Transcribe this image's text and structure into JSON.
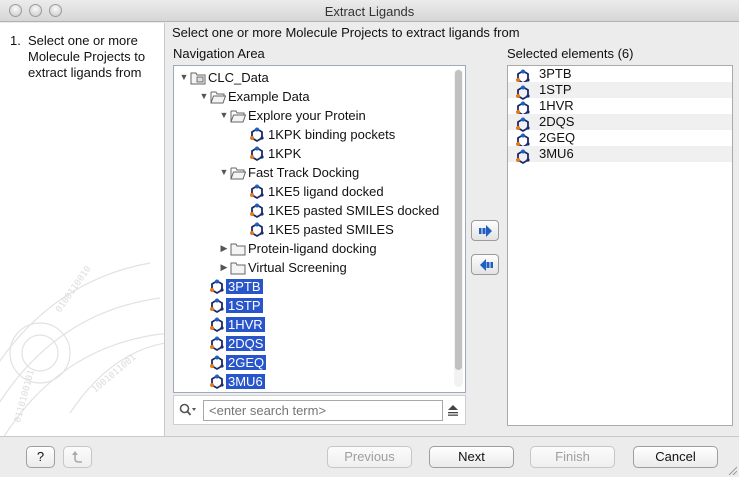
{
  "window": {
    "title": "Extract Ligands"
  },
  "wizard": {
    "steps": [
      {
        "number": "1.",
        "text": "Select one or more Molecule Projects to extract ligands from"
      }
    ],
    "instruction": "Select one or more Molecule Projects to extract ligands from"
  },
  "navigation": {
    "label": "Navigation Area",
    "tree": [
      {
        "label": "CLC_Data",
        "depth": 0,
        "expanded": true,
        "icon": "database-folder-icon"
      },
      {
        "label": "Example Data",
        "depth": 1,
        "expanded": true,
        "icon": "folder-open-icon"
      },
      {
        "label": "Explore your Protein",
        "depth": 2,
        "expanded": true,
        "icon": "folder-open-icon"
      },
      {
        "label": "1KPK binding pockets",
        "depth": 3,
        "icon": "molecule-project-icon"
      },
      {
        "label": "1KPK",
        "depth": 3,
        "icon": "molecule-project-icon"
      },
      {
        "label": "Fast Track Docking",
        "depth": 2,
        "expanded": true,
        "icon": "folder-open-icon"
      },
      {
        "label": "1KE5 ligand docked",
        "depth": 3,
        "icon": "molecule-project-icon"
      },
      {
        "label": "1KE5 pasted SMILES docked",
        "depth": 3,
        "icon": "molecule-project-icon"
      },
      {
        "label": "1KE5 pasted SMILES",
        "depth": 3,
        "icon": "molecule-project-icon"
      },
      {
        "label": "Protein-ligand docking",
        "depth": 2,
        "expanded": false,
        "icon": "folder-closed-icon"
      },
      {
        "label": "Virtual Screening",
        "depth": 2,
        "expanded": false,
        "icon": "folder-closed-icon"
      },
      {
        "label": "3PTB",
        "depth": 1,
        "selected": true,
        "icon": "molecule-project-icon"
      },
      {
        "label": "1STP",
        "depth": 1,
        "selected": true,
        "icon": "molecule-project-icon"
      },
      {
        "label": "1HVR",
        "depth": 1,
        "selected": true,
        "icon": "molecule-project-icon"
      },
      {
        "label": "2DQS",
        "depth": 1,
        "selected": true,
        "icon": "molecule-project-icon"
      },
      {
        "label": "2GEQ",
        "depth": 1,
        "selected": true,
        "icon": "molecule-project-icon"
      },
      {
        "label": "3MU6",
        "depth": 1,
        "selected": true,
        "icon": "molecule-project-icon"
      }
    ]
  },
  "search": {
    "placeholder": "<enter search term>",
    "value": ""
  },
  "selected": {
    "label": "Selected elements (6)",
    "items": [
      "3PTB",
      "1STP",
      "1HVR",
      "2DQS",
      "2GEQ",
      "3MU6"
    ]
  },
  "buttons": {
    "help": "?",
    "previous": "Previous",
    "next": "Next",
    "finish": "Finish",
    "cancel": "Cancel"
  },
  "colors": {
    "selection": "#2855c9",
    "accent_blue": "#1f5fbf",
    "molecule_orange": "#e07a1f"
  }
}
